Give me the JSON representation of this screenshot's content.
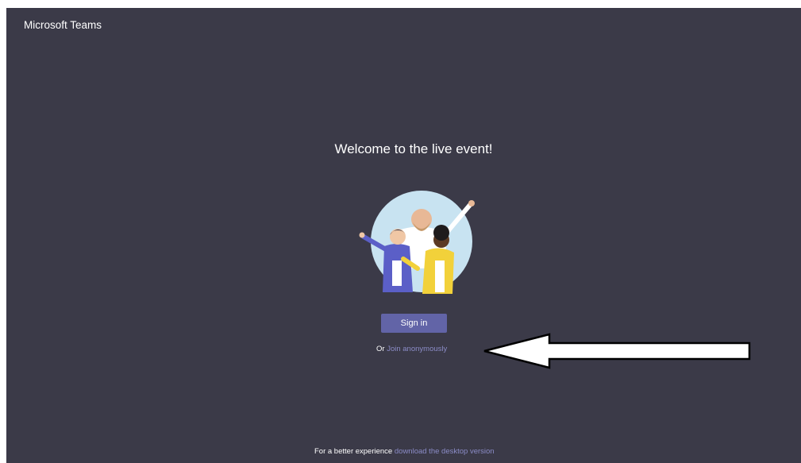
{
  "app": {
    "title": "Microsoft Teams"
  },
  "main": {
    "heading": "Welcome to the live event!",
    "sign_in_label": "Sign in",
    "or_text": "Or",
    "join_anon_label": "Join anonymously"
  },
  "footer": {
    "text": "For a better experience",
    "link_label": "download the desktop version"
  },
  "colors": {
    "background": "#3b3a48",
    "accent": "#6264a7",
    "link": "#8b8cc7"
  },
  "icons": [
    "welcome-illustration",
    "annotation-arrow"
  ]
}
